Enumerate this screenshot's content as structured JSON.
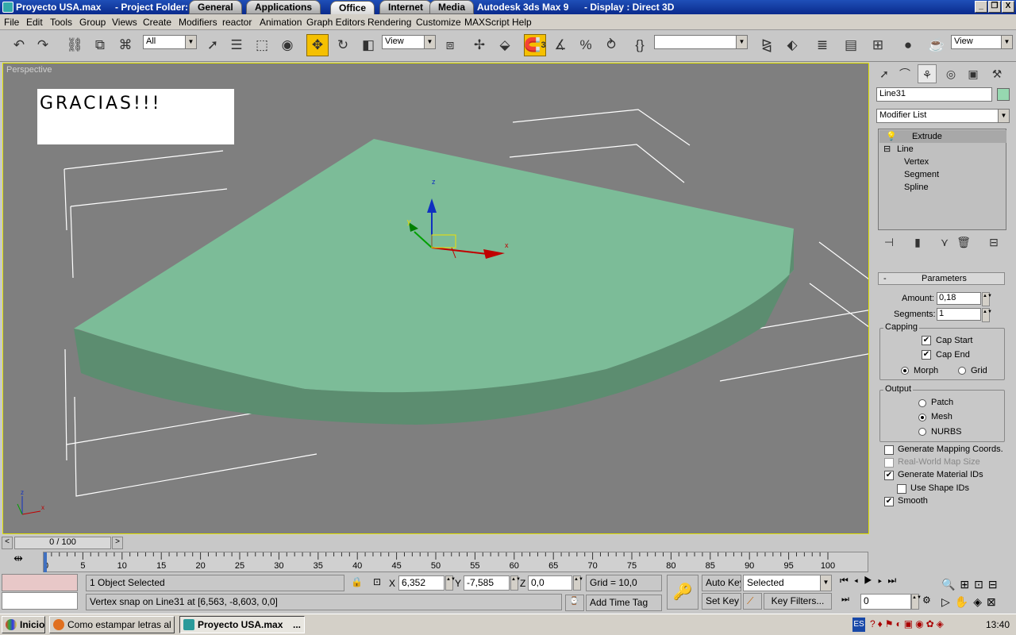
{
  "window": {
    "title": "Proyecto USA.max",
    "project_label": "- Project Folder:",
    "tabs": [
      "General",
      "Applications",
      "Office",
      "Internet",
      "Media"
    ],
    "active_tab": "Office",
    "app_title": "Autodesk 3ds Max 9",
    "display": "- Display : Direct 3D",
    "min": "_",
    "max": "❐",
    "close": "X"
  },
  "menu": [
    "File",
    "Edit",
    "Tools",
    "Group",
    "Views",
    "Create",
    "Modifiers",
    "reactor",
    "Animation",
    "Graph Editors",
    "Rendering",
    "Customize",
    "MAXScript",
    "Help"
  ],
  "toolbar": {
    "selection_filter": "All",
    "ref_coord": "View",
    "ref_coord_right": "View",
    "snap_badge": "3"
  },
  "viewport": {
    "label": "Perspective",
    "note_text": "GRACIAS!!!",
    "gizmo": {
      "x": "x",
      "y": "y",
      "z": "z"
    },
    "axis_x": "x",
    "axis_z": "z",
    "mesh_color": "#7cbc98",
    "bg_color": "#7f7f7f"
  },
  "panel": {
    "tab_icons": [
      "pointer-icon",
      "create-icon",
      "modify-icon",
      "hierarchy-icon",
      "motion-icon",
      "display-icon",
      "utilities-icon"
    ],
    "object_name": "Line31",
    "object_color": "#96d8b0",
    "modifier_list": "Modifier List",
    "stack": [
      {
        "label": "Extrude",
        "selected": true
      },
      {
        "label": "Line",
        "expand": "⊟"
      },
      {
        "label": "Vertex",
        "child": true
      },
      {
        "label": "Segment",
        "child": true
      },
      {
        "label": "Spline",
        "child": true
      }
    ],
    "rollout": "Parameters",
    "collapse": "-",
    "amount_label": "Amount:",
    "amount": "0,18",
    "segments_label": "Segments:",
    "segments": "1",
    "capping": {
      "title": "Capping",
      "cap_start": "Cap Start",
      "cap_end": "Cap End",
      "morph": "Morph",
      "grid": "Grid"
    },
    "output": {
      "title": "Output",
      "patch": "Patch",
      "mesh": "Mesh",
      "nurbs": "NURBS"
    },
    "checks": [
      {
        "label": "Generate Mapping Coords.",
        "checked": false,
        "disabled": false
      },
      {
        "label": "Real-World Map Size",
        "checked": false,
        "disabled": true
      },
      {
        "label": "Generate Material IDs",
        "checked": true,
        "disabled": false
      },
      {
        "label": "Use Shape IDs",
        "checked": false,
        "disabled": false
      },
      {
        "label": "Smooth",
        "checked": true,
        "disabled": false
      }
    ]
  },
  "timeline": {
    "slider": "0 / 100",
    "prev": "<",
    "next": ">",
    "ticks": [
      "0",
      "5",
      "10",
      "15",
      "20",
      "25",
      "30",
      "35",
      "40",
      "45",
      "50",
      "55",
      "60",
      "65",
      "70",
      "75",
      "80",
      "85",
      "90",
      "95",
      "100"
    ]
  },
  "status": {
    "selected": "1 Object Selected",
    "prompt": "Vertex snap on Line31 at [6,563, -8,603, 0,0]",
    "x_label": "X",
    "x": "6,352",
    "y_label": "Y",
    "y": "-7,585",
    "z_label": "Z",
    "z": "0,0",
    "grid": "Grid = 10,0",
    "add_time_tag": "Add Time Tag",
    "auto_key": "Auto Key",
    "set_key": "Set Key",
    "selected_dd": "Selected",
    "key_filters": "Key Filters...",
    "frame": "0"
  },
  "taskbar": {
    "start": "Inicio",
    "tasks": [
      "Como estampar letras al ...",
      "Proyecto USA.max"
    ],
    "more": "...",
    "lang": "ES",
    "clock": "13:40"
  }
}
